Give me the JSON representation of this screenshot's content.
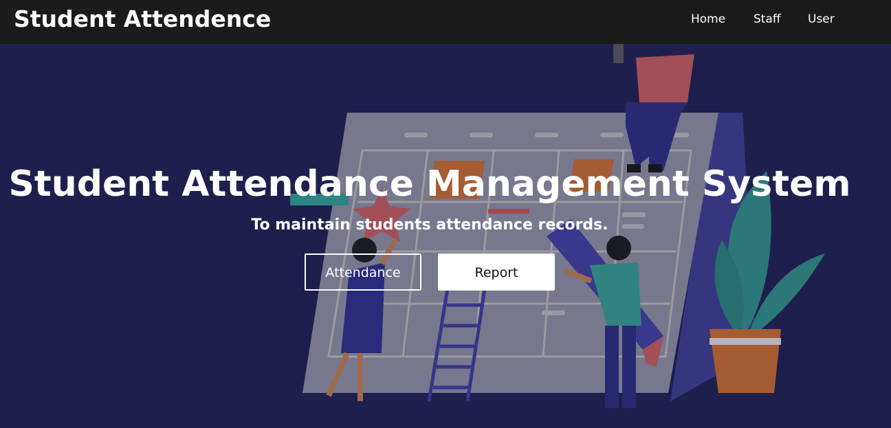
{
  "navbar": {
    "brand": "Student Attendence",
    "links": [
      "Home",
      "Staff",
      "User"
    ]
  },
  "hero": {
    "title": "Student Attendance Management System",
    "subtitle": "To maintain students attendance records.",
    "buttons": {
      "attendance": "Attendance",
      "report": "Report"
    }
  },
  "colors": {
    "navbar_bg": "#1b1b1b",
    "hero_bg": "#1f1f4f",
    "text": "#ffffff",
    "button_solid_bg": "#ffffff",
    "button_solid_text": "#111111"
  }
}
